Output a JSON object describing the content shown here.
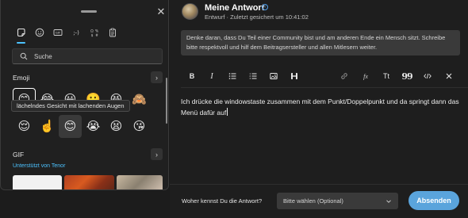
{
  "emoji_panel": {
    "categories": [
      {
        "icon": "sticker-icon",
        "active": true
      },
      {
        "icon": "smiley-icon",
        "active": false
      },
      {
        "icon": "gif-icon",
        "active": false
      },
      {
        "icon": "kaomoji-icon",
        "active": false
      },
      {
        "icon": "symbols-icon",
        "active": false
      },
      {
        "icon": "clipboard-icon",
        "active": false
      }
    ],
    "search": {
      "placeholder": "Suche",
      "value": ""
    },
    "emoji_section": {
      "title": "Emoji"
    },
    "emoji_row1": [
      "😊",
      "😂",
      "😀",
      "🙂",
      "😆",
      "🙈"
    ],
    "emoji_row2": [
      "😌",
      "☝️",
      "😊",
      "😭",
      "😫",
      "😘"
    ],
    "tooltip": "lächelndes Gesicht mit lachenden Augen",
    "gif_section": {
      "title": "GIF",
      "provider": "Unterstützt von Tenor"
    }
  },
  "editor": {
    "title": "Meine Antwort",
    "status": "Entwurf · Zuletzt gesichert um 10:41:02",
    "notice": "Denke daran, dass Du Teil einer Community bist und am anderen Ende ein Mensch sitzt. Schreibe bitte respektvoll und hilf dem Beitragsersteller und allen Mitlesern weiter.",
    "toolbar": {
      "bold": "B",
      "italic": "I",
      "heading": "Tt",
      "quote": "99",
      "formula": "fx"
    },
    "body": "Ich drücke die windowstaste zusammen mit dem Punkt/Doppelpunkt und da springt dann das Menü dafür auf",
    "footer": {
      "source_label": "Woher kennst Du die Antwort?",
      "source_select": "Bitte wählen (Optional)",
      "submit": "Absenden"
    }
  },
  "colors": {
    "accent": "#4cc2ff",
    "submit_button": "#5aa4dc",
    "background": "#1e1e1e"
  }
}
